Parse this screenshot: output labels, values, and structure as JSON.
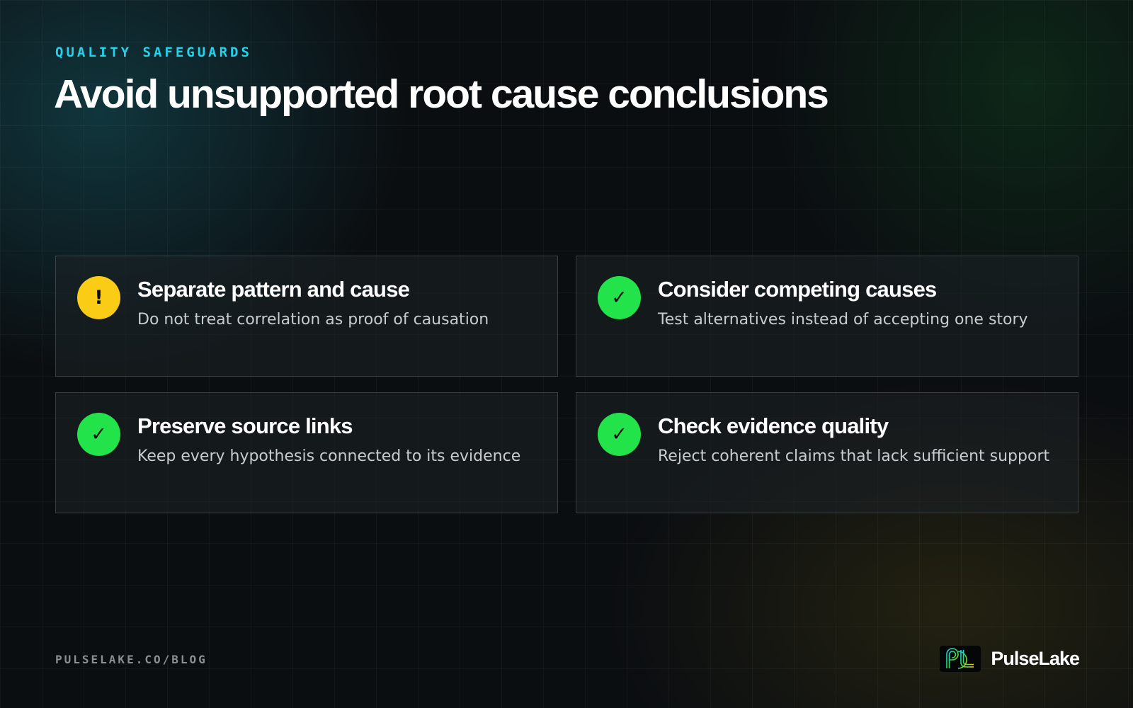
{
  "header": {
    "eyebrow": "QUALITY SAFEGUARDS",
    "title": "Avoid unsupported root cause conclusions"
  },
  "cards": [
    {
      "status": "warning",
      "icon": "exclamation-icon",
      "glyph": "!",
      "color": "#facc15",
      "title": "Separate pattern and cause",
      "description": "Do not treat correlation as proof of causation"
    },
    {
      "status": "ok",
      "icon": "check-icon",
      "glyph": "✓",
      "color": "#22e34a",
      "title": "Consider competing causes",
      "description": "Test alternatives instead of accepting one story"
    },
    {
      "status": "ok",
      "icon": "check-icon",
      "glyph": "✓",
      "color": "#22e34a",
      "title": "Preserve source links",
      "description": "Keep every hypothesis connected to its evidence"
    },
    {
      "status": "ok",
      "icon": "check-icon",
      "glyph": "✓",
      "color": "#22e34a",
      "title": "Check evidence quality",
      "description": "Reject coherent claims that lack sufficient support"
    }
  ],
  "footer": {
    "url": "PULSELAKE.CO/BLOG",
    "brand_name": "PulseLake",
    "brand_icon": "pulselake-logo-icon"
  },
  "colors": {
    "accent": "#22d3ee",
    "background": "#0b0e11",
    "warning": "#facc15",
    "success": "#22e34a"
  }
}
